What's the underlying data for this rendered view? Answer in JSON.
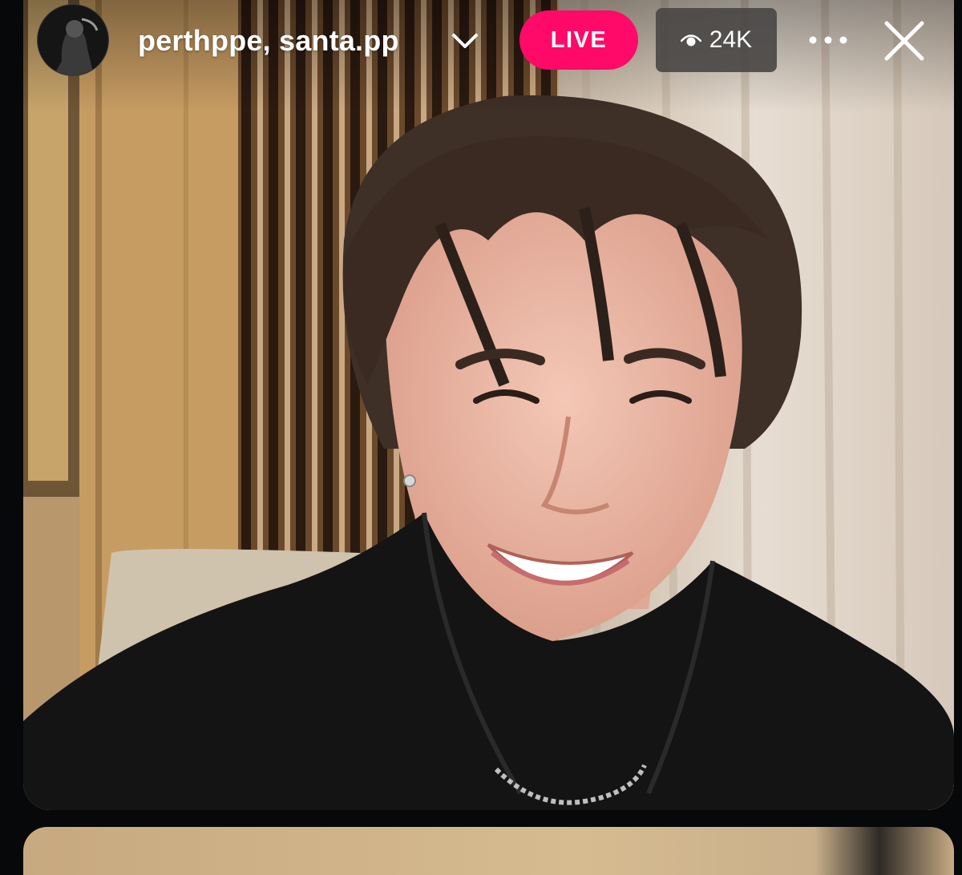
{
  "header": {
    "host_names": "perthppe, santa.pp",
    "live_label": "LIVE",
    "viewer_count": "24K"
  },
  "icons": {
    "avatar": "profile-avatar",
    "expand": "chevron-down-icon",
    "viewers": "eye-icon",
    "more": "more-horizontal-icon",
    "close": "close-icon"
  },
  "colors": {
    "live_badge": "#ff0a69",
    "viewer_badge": "#4a4846",
    "background": "#06080a"
  }
}
